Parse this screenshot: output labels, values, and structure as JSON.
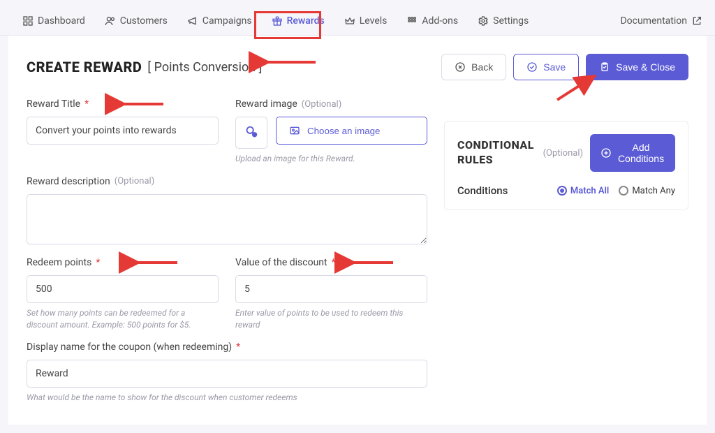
{
  "nav": {
    "dashboard": "Dashboard",
    "customers": "Customers",
    "campaigns": "Campaigns",
    "rewards": "Rewards",
    "levels": "Levels",
    "addons": "Add-ons",
    "settings": "Settings",
    "documentation": "Documentation"
  },
  "header": {
    "title": "CREATE REWARD",
    "subtitle": "[ Points Conversion ]",
    "back": "Back",
    "save": "Save",
    "save_close": "Save & Close"
  },
  "form": {
    "reward_title_label": "Reward Title",
    "reward_title_value": "Convert your points into rewards",
    "reward_image_label": "Reward image",
    "optional_text": "(Optional)",
    "choose_image": "Choose an image",
    "image_helper": "Upload an image for this Reward.",
    "description_label": "Reward description",
    "description_value": "",
    "redeem_points_label": "Redeem points",
    "redeem_points_value": "500",
    "redeem_points_helper": "Set how many points can be redeemed for a discount amount. Example: 500 points for $5.",
    "discount_value_label": "Value of the discount",
    "discount_value_value": "5",
    "discount_value_helper": "Enter value of points to be used to redeem this reward",
    "display_name_label": "Display name for the coupon (when redeeming)",
    "display_name_value": "Reward",
    "display_name_helper": "What would be the name to show for the discount when customer redeems"
  },
  "rules": {
    "title": "CONDITIONAL RULES",
    "optional": "(Optional)",
    "add_conditions": "Add Conditions",
    "conditions_label": "Conditions",
    "match_all": "Match All",
    "match_any": "Match Any"
  }
}
